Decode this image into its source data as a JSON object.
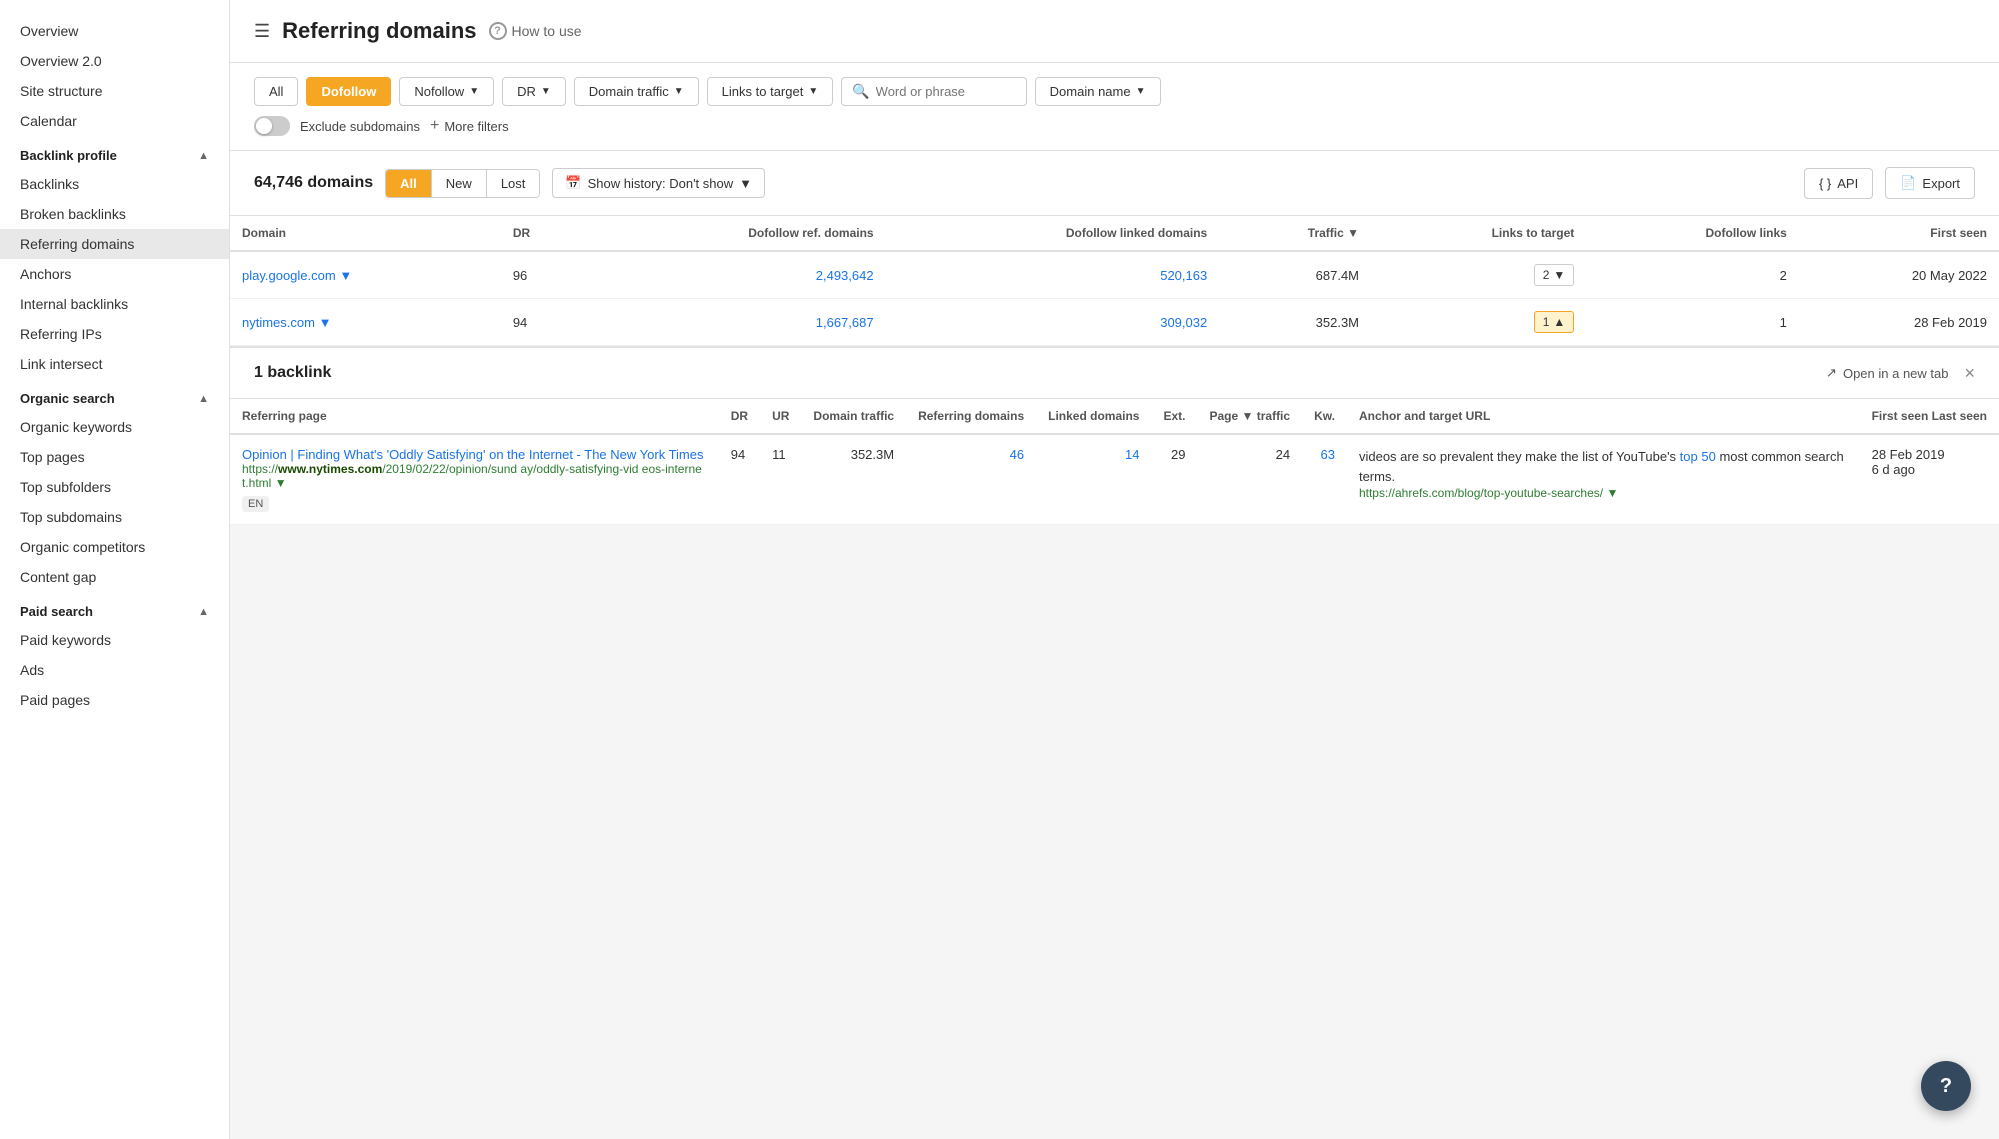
{
  "sidebar": {
    "items_top": [
      {
        "id": "overview",
        "label": "Overview",
        "active": false
      },
      {
        "id": "overview2",
        "label": "Overview 2.0",
        "active": false
      },
      {
        "id": "site-structure",
        "label": "Site structure",
        "active": false
      },
      {
        "id": "calendar",
        "label": "Calendar",
        "active": false
      }
    ],
    "sections": [
      {
        "id": "backlink-profile",
        "label": "Backlink profile",
        "expanded": true,
        "items": [
          {
            "id": "backlinks",
            "label": "Backlinks",
            "active": false
          },
          {
            "id": "broken-backlinks",
            "label": "Broken backlinks",
            "active": false
          },
          {
            "id": "referring-domains",
            "label": "Referring domains",
            "active": true
          },
          {
            "id": "anchors",
            "label": "Anchors",
            "active": false
          },
          {
            "id": "internal-backlinks",
            "label": "Internal backlinks",
            "active": false
          },
          {
            "id": "referring-ips",
            "label": "Referring IPs",
            "active": false
          },
          {
            "id": "link-intersect",
            "label": "Link intersect",
            "active": false
          }
        ]
      },
      {
        "id": "organic-search",
        "label": "Organic search",
        "expanded": true,
        "items": [
          {
            "id": "organic-keywords",
            "label": "Organic keywords",
            "active": false
          },
          {
            "id": "top-pages",
            "label": "Top pages",
            "active": false
          },
          {
            "id": "top-subfolders",
            "label": "Top subfolders",
            "active": false
          },
          {
            "id": "top-subdomains",
            "label": "Top subdomains",
            "active": false
          },
          {
            "id": "organic-competitors",
            "label": "Organic competitors",
            "active": false
          },
          {
            "id": "content-gap",
            "label": "Content gap",
            "active": false
          }
        ]
      },
      {
        "id": "paid-search",
        "label": "Paid search",
        "expanded": true,
        "items": [
          {
            "id": "paid-keywords",
            "label": "Paid keywords",
            "active": false
          },
          {
            "id": "ads",
            "label": "Ads",
            "active": false
          },
          {
            "id": "paid-pages",
            "label": "Paid pages",
            "active": false
          }
        ]
      }
    ]
  },
  "page": {
    "title": "Referring domains",
    "help_label": "How to use"
  },
  "filters": {
    "btn_all": "All",
    "btn_dofollow": "Dofollow",
    "btn_nofollow": "Nofollow",
    "btn_dr": "DR",
    "btn_domain_traffic": "Domain traffic",
    "btn_links_to_target": "Links to target",
    "search_placeholder": "Word or phrase",
    "btn_domain_name": "Domain name",
    "toggle_label": "Exclude subdomains",
    "more_filters": "More filters"
  },
  "table_header": {
    "domain_count": "64,746 domains",
    "tab_all": "All",
    "tab_new": "New",
    "tab_lost": "Lost",
    "history_label": "Show history: Don't show",
    "api_label": "API",
    "export_label": "Export"
  },
  "columns": {
    "domain": "Domain",
    "dr": "DR",
    "dofollow_ref": "Dofollow ref. domains",
    "dofollow_linked": "Dofollow linked domains",
    "traffic": "Traffic",
    "links_to_target": "Links to target",
    "dofollow_links": "Dofollow links",
    "first_seen": "First seen"
  },
  "rows": [
    {
      "domain": "play.google.com",
      "dr": "96",
      "dofollow_ref": "2,493,642",
      "dofollow_linked": "520,163",
      "traffic": "687.4M",
      "links_to_target": "2",
      "dofollow_links": "2",
      "first_seen": "20 May 2022",
      "expanded": false
    },
    {
      "domain": "nytimes.com",
      "dr": "94",
      "dofollow_ref": "1,667,687",
      "dofollow_linked": "309,032",
      "traffic": "352.3M",
      "links_to_target": "1",
      "dofollow_links": "1",
      "first_seen": "28 Feb 2019",
      "expanded": true
    }
  ],
  "expanded_panel": {
    "backlink_count": "1 backlink",
    "open_tab_label": "Open in a new tab",
    "close_label": "×",
    "inner_columns": {
      "referring_page": "Referring page",
      "dr": "DR",
      "ur": "UR",
      "domain_traffic": "Domain traffic",
      "referring_domains": "Referring domains",
      "linked_domains": "Linked domains",
      "ext": "Ext.",
      "page_traffic": "Page ▼ traffic",
      "kw": "Kw.",
      "anchor_target": "Anchor and target URL",
      "first_last_seen": "First seen Last seen"
    },
    "inner_row": {
      "title": "Opinion | Finding What's 'Oddly Satisfying' on the Internet - The New York Times",
      "url_base": "https://www.nytimes.com",
      "url_path": "/2019/02/22/opinion/sunday/oddly-satisfying-videos-internet.html",
      "dr": "94",
      "ur": "11",
      "domain_traffic": "352.3M",
      "referring_domains": "46",
      "linked_domains": "14",
      "ext": "29",
      "page_traffic": "24",
      "kw": "63",
      "anchor_text_before": "videos are so prevalent they make the list of YouTube's ",
      "anchor_link_text": "top 50",
      "anchor_text_after": " most common search terms.",
      "target_url": "https://ahrefs.com/blog/top-youtube-searches/",
      "first_seen": "28 Feb 2019",
      "last_seen": "6 d ago",
      "lang": "EN"
    }
  },
  "fab": {
    "label": "?"
  }
}
